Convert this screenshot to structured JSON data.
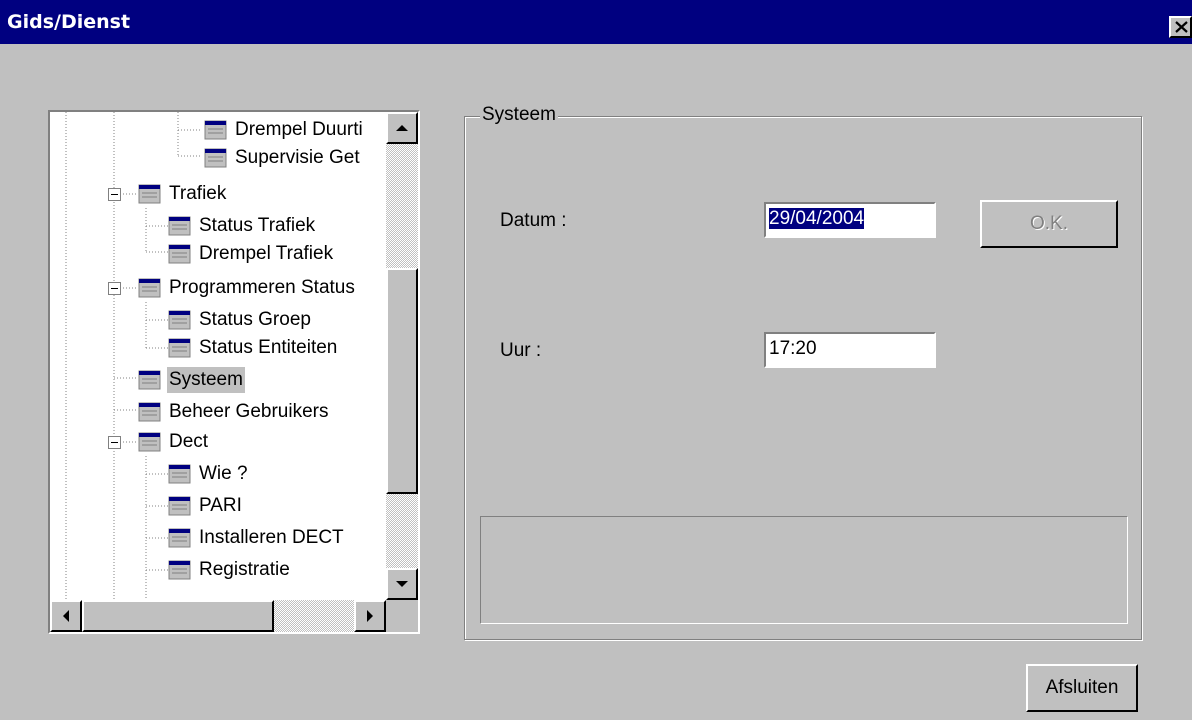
{
  "window": {
    "title": "Gids/Dienst"
  },
  "tree": {
    "items": [
      {
        "label": "Drempel Duurti"
      },
      {
        "label": "Supervisie Get"
      },
      {
        "label": "Trafiek"
      },
      {
        "label": "Status Trafiek"
      },
      {
        "label": "Drempel Trafiek"
      },
      {
        "label": "Programmeren Status"
      },
      {
        "label": "Status Groep"
      },
      {
        "label": "Status Entiteiten"
      },
      {
        "label": "Systeem"
      },
      {
        "label": "Beheer Gebruikers"
      },
      {
        "label": "Dect"
      },
      {
        "label": "Wie ?"
      },
      {
        "label": "PARI"
      },
      {
        "label": "Installeren DECT"
      },
      {
        "label": "Registratie"
      }
    ],
    "selected": "Systeem"
  },
  "systeem": {
    "group_title": "Systeem",
    "datum_label": "Datum :",
    "datum_value": "29/04/2004",
    "uur_label": "Uur :",
    "uur_value": "17:20",
    "ok_label": "O.K."
  },
  "footer": {
    "close_label": "Afsluiten"
  },
  "colors": {
    "titlebar": "#000080",
    "face": "#c0c0c0",
    "selection": "#000080"
  }
}
